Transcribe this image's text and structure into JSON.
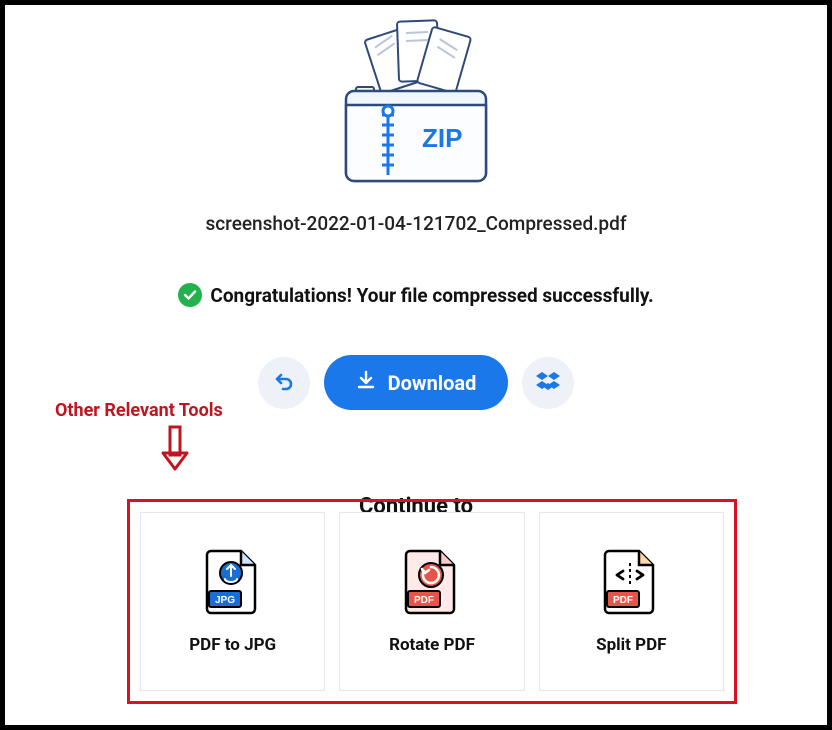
{
  "file": {
    "name": "screenshot-2022-01-04-121702_Compressed.pdf"
  },
  "status": {
    "message": "Congratulations! Your file compressed successfully."
  },
  "buttons": {
    "download": "Download"
  },
  "continue": {
    "heading": "Continue to"
  },
  "annotation": {
    "text": "Other Relevant Tools"
  },
  "tools": [
    {
      "label": "PDF to JPG"
    },
    {
      "label": "Rotate PDF"
    },
    {
      "label": "Split PDF"
    }
  ]
}
